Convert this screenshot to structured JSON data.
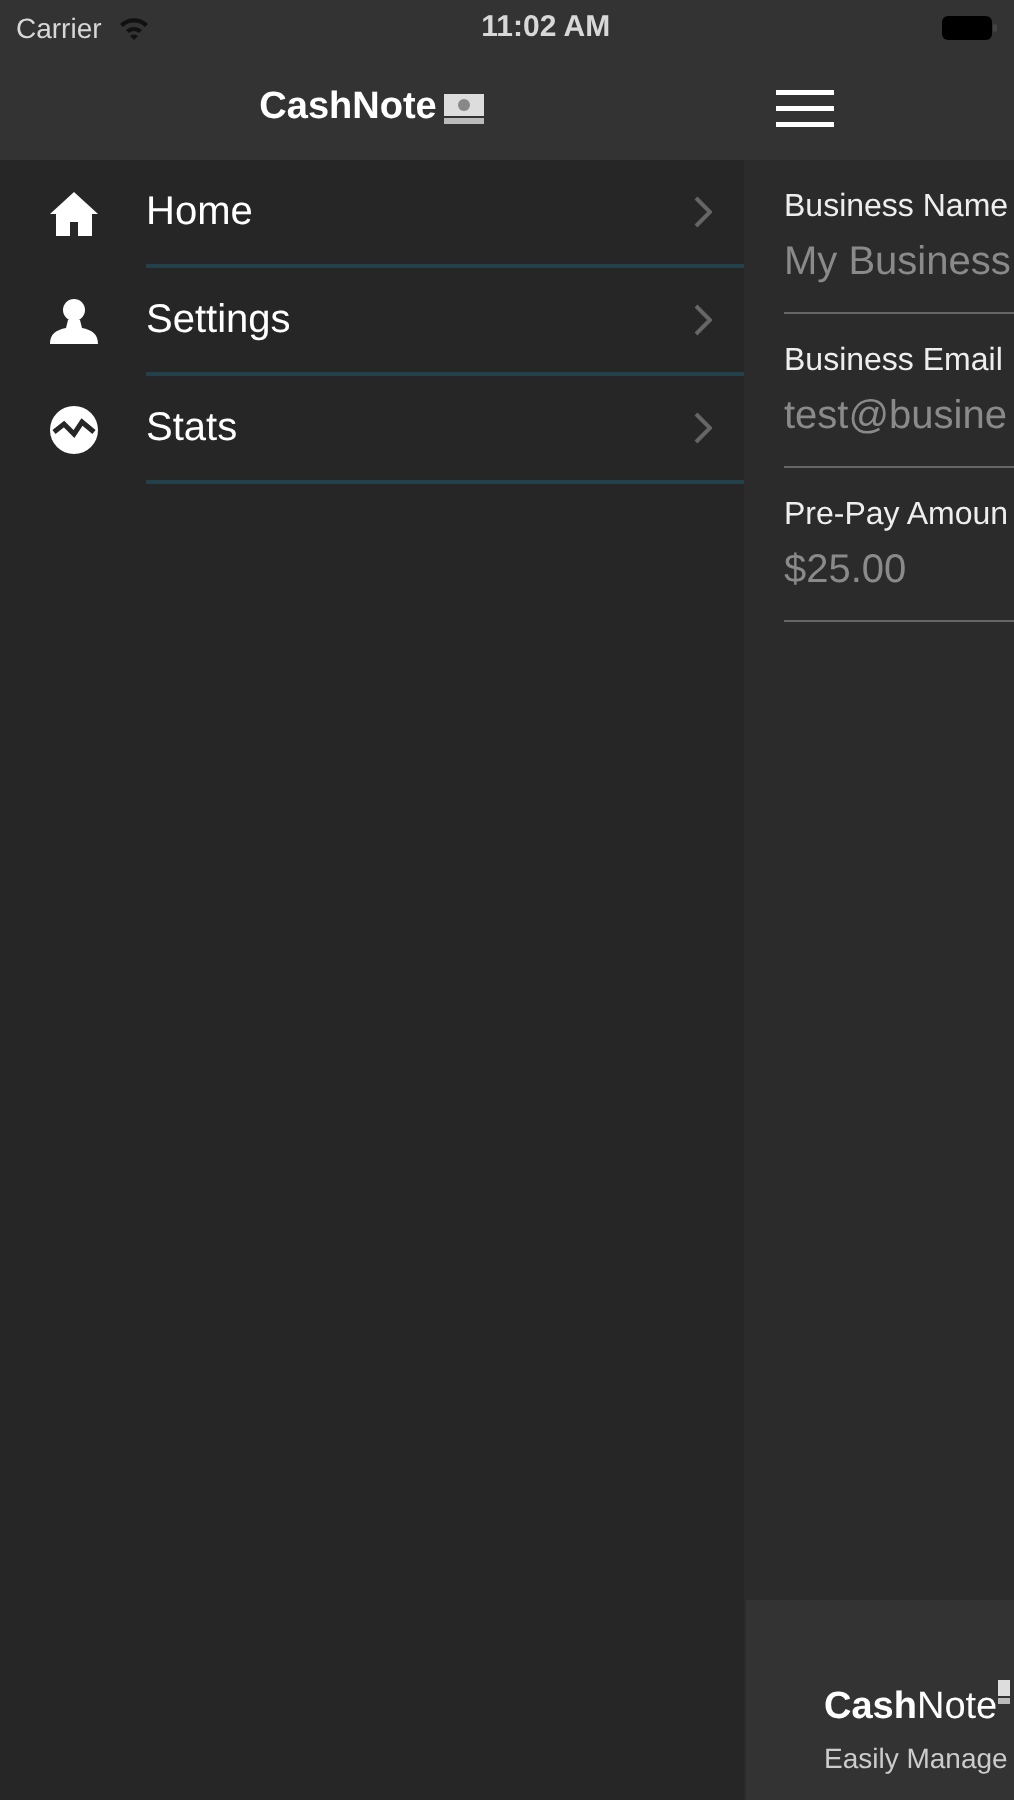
{
  "status_bar": {
    "carrier": "Carrier",
    "time": "11:02 AM"
  },
  "drawer": {
    "title": "CashNote",
    "items": [
      {
        "label": "Home",
        "kind": "home"
      },
      {
        "label": "Settings",
        "kind": "person"
      },
      {
        "label": "Stats",
        "kind": "stats"
      }
    ]
  },
  "panel": {
    "fields": [
      {
        "label": "Business Name",
        "value": "My Business"
      },
      {
        "label": "Business Email",
        "value": "test@busine"
      },
      {
        "label": "Pre-Pay Amoun",
        "value": "$25.00"
      }
    ],
    "footer": {
      "title": "**Cash**Note",
      "subtitle": "Easily Manage"
    }
  }
}
